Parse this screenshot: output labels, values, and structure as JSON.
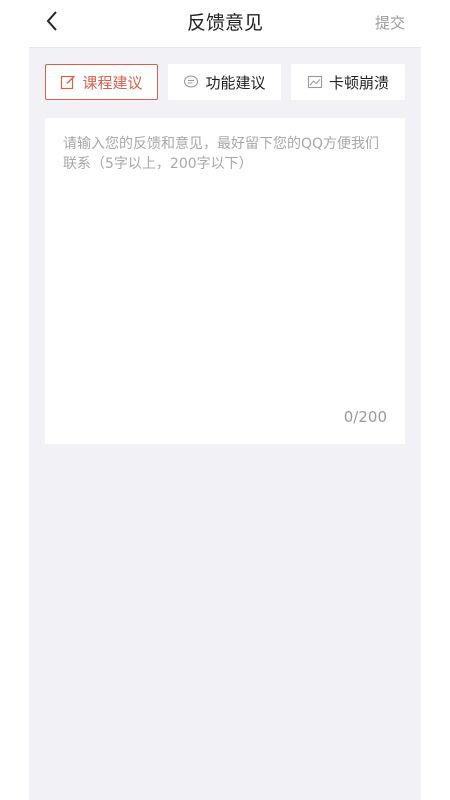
{
  "header": {
    "title": "反馈意见",
    "submit_label": "提交",
    "back_icon": "chevron-left-icon"
  },
  "tabs": [
    {
      "label": "课程建议",
      "icon": "edit-icon",
      "active": true
    },
    {
      "label": "功能建议",
      "icon": "message-icon",
      "active": false
    },
    {
      "label": "卡顿崩溃",
      "icon": "image-icon",
      "active": false
    }
  ],
  "feedback": {
    "value": "",
    "placeholder": "请输入您的反馈和意见，最好留下您的QQ方便我们联系（5字以上，200字以下）",
    "counter": "0/200"
  },
  "colors": {
    "accent": "#d8604e",
    "background": "#f2f2f6",
    "muted_text": "#9a9a9a"
  }
}
